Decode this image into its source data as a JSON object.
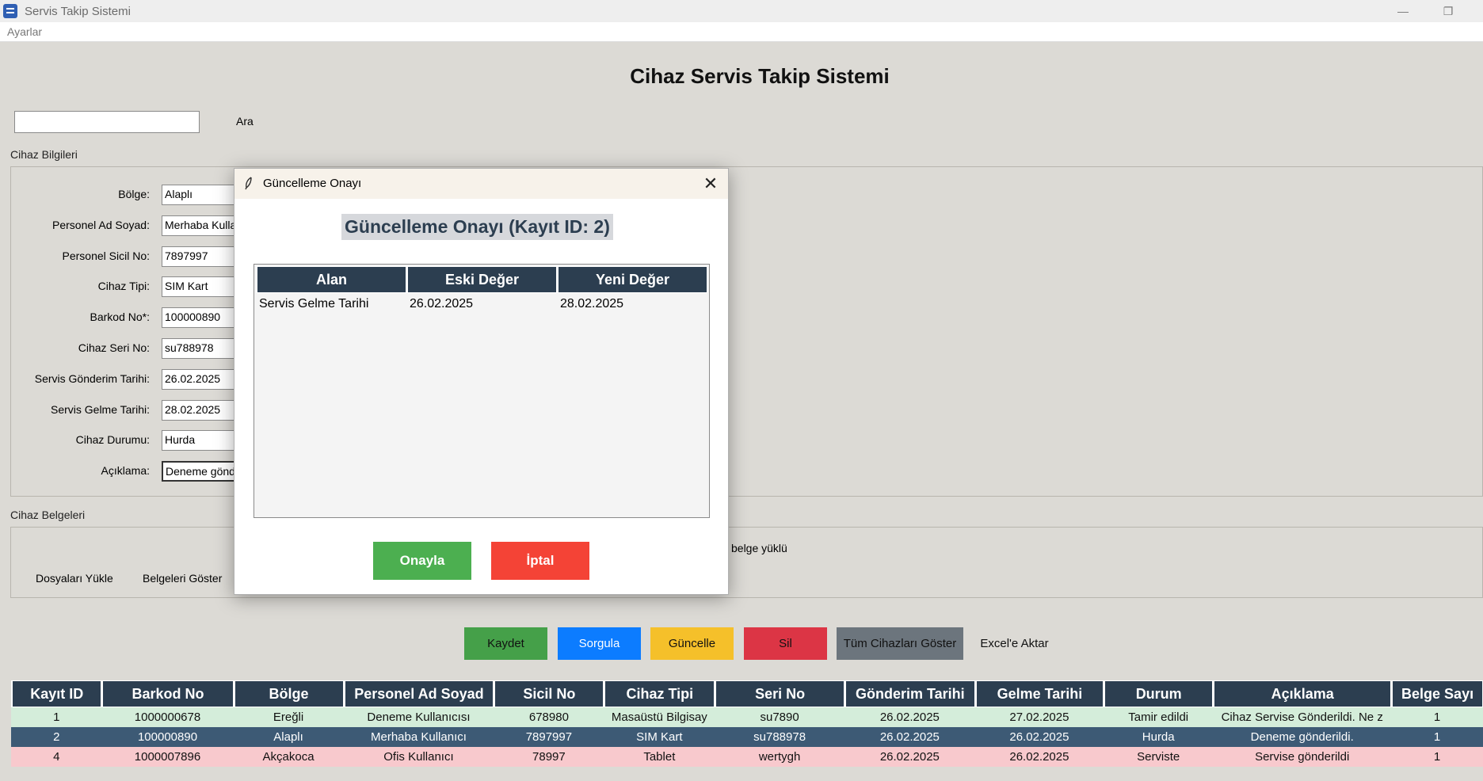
{
  "window": {
    "title": "Servis Takip Sistemi"
  },
  "menu": {
    "settings": "Ayarlar"
  },
  "page_title": "Cihaz Servis Takip Sistemi",
  "search": {
    "value": "",
    "button": "Ara"
  },
  "device_info": {
    "section_title": "Cihaz Bilgileri",
    "fields": [
      {
        "label": "Bölge:",
        "value": "Alaplı"
      },
      {
        "label": "Personel Ad Soyad:",
        "value": "Merhaba Kullanıcı"
      },
      {
        "label": "Personel Sicil No:",
        "value": "7897997"
      },
      {
        "label": "Cihaz Tipi:",
        "value": "SIM Kart"
      },
      {
        "label": "Barkod No*:",
        "value": "100000890"
      },
      {
        "label": "Cihaz Seri No:",
        "value": "su788978"
      },
      {
        "label": "Servis Gönderim Tarihi:",
        "value": "26.02.2025"
      },
      {
        "label": "Servis Gelme Tarihi:",
        "value": "28.02.2025"
      },
      {
        "label": "Cihaz Durumu:",
        "value": "Hurda"
      },
      {
        "label": "Açıklama:",
        "value": "Deneme gönderildi."
      }
    ]
  },
  "documents": {
    "section_title": "Cihaz Belgeleri",
    "upload_button": "Dosyaları Yükle",
    "show_button": "Belgeleri Göster",
    "status": "l belge yüklü"
  },
  "actions": {
    "save": "Kaydet",
    "query": "Sorgula",
    "update": "Güncelle",
    "delete": "Sil",
    "show_all": "Tüm Cihazları Göster",
    "export": "Excel'e Aktar"
  },
  "colors": {
    "save": "#45a049",
    "query": "#0c7cff",
    "update": "#f5c02a",
    "delete": "#dc3545",
    "show_all": "#6c757d",
    "header": "#2c3e50",
    "confirm": "#4caf50",
    "cancel": "#f44336"
  },
  "table": {
    "columns": [
      "Kayıt ID",
      "Barkod No",
      "Bölge",
      "Personel Ad Soyad",
      "Sicil No",
      "Cihaz Tipi",
      "Seri No",
      "Gönderim Tarihi",
      "Gelme Tarihi",
      "Durum",
      "Açıklama",
      "Belge Sayı"
    ],
    "rows": [
      [
        "1",
        "1000000678",
        "Ereğli",
        "Deneme Kullanıcısı",
        "678980",
        "Masaüstü Bilgisay",
        "su7890",
        "26.02.2025",
        "27.02.2025",
        "Tamir edildi",
        "Cihaz Servise Gönderildi. Ne z",
        "1"
      ],
      [
        "2",
        "100000890",
        "Alaplı",
        "Merhaba Kullanıcı",
        "7897997",
        "SIM Kart",
        "su788978",
        "26.02.2025",
        "26.02.2025",
        "Hurda",
        "Deneme gönderildi.",
        "1"
      ],
      [
        "4",
        "1000007896",
        "Akçakoca",
        "Ofis Kullanıcı",
        "78997",
        "Tablet",
        "wertygh",
        "26.02.2025",
        "26.02.2025",
        "Serviste",
        "Servise gönderildi",
        "1"
      ]
    ]
  },
  "dialog": {
    "title": "Güncelleme Onayı",
    "heading": "Güncelleme Onayı (Kayıt ID: 2)",
    "columns": [
      "Alan",
      "Eski Değer",
      "Yeni Değer"
    ],
    "rows": [
      [
        "Servis Gelme Tarihi",
        "26.02.2025",
        "28.02.2025"
      ]
    ],
    "confirm": "Onayla",
    "cancel": "İptal"
  }
}
